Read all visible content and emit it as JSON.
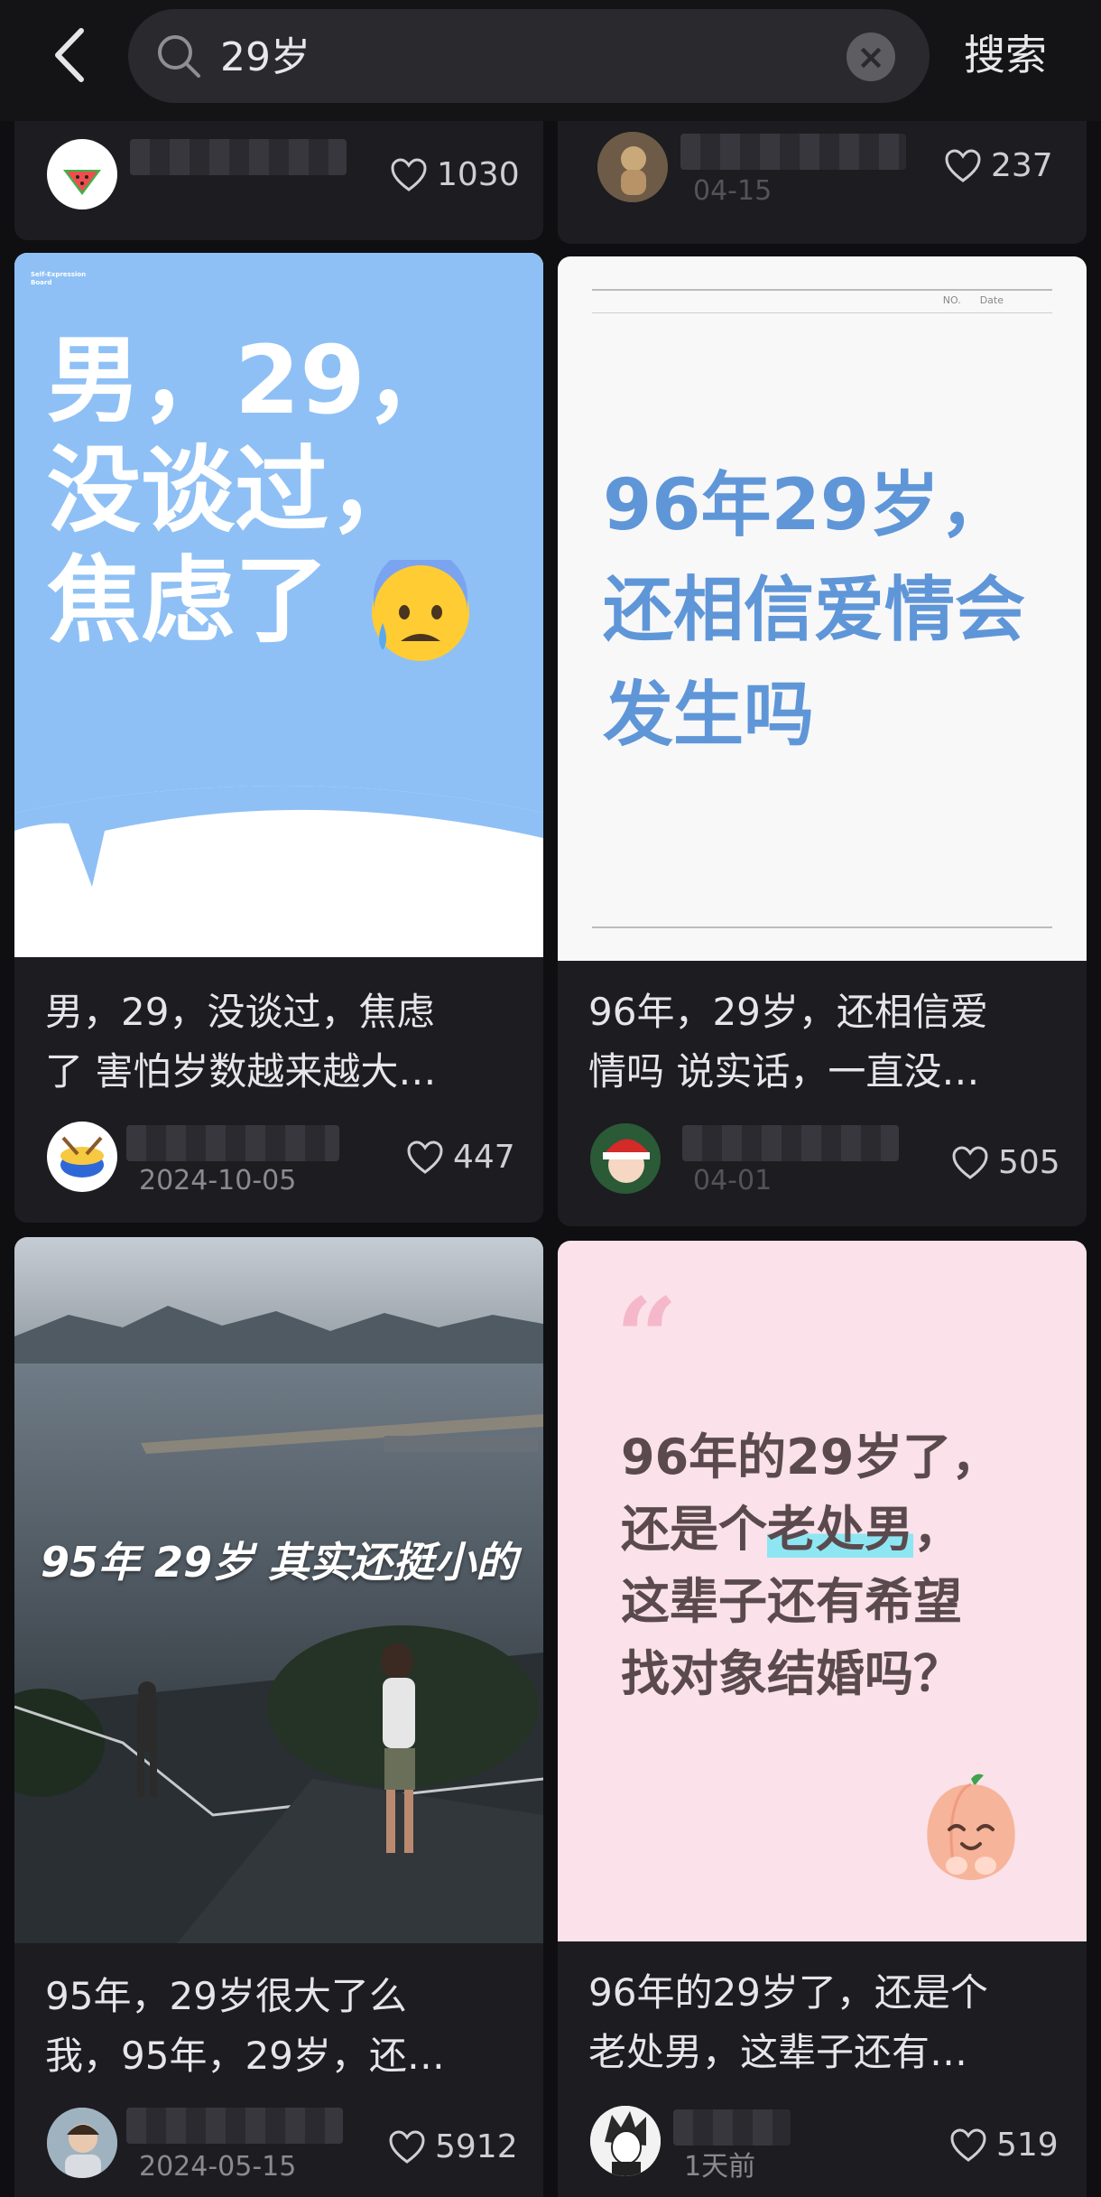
{
  "search": {
    "query": "29岁",
    "button_label": "搜索"
  },
  "cards": [
    {
      "likes": "1030"
    },
    {
      "likes": "237",
      "date": "04-15"
    },
    {
      "cover_badge": "Self-Expression\nBoard",
      "cover_line1": "男，29，",
      "cover_line2": "没谈过，",
      "cover_line3": "焦虑了",
      "title_line1": "男，29，没谈过，焦虑",
      "title_line2": "了 害怕岁数越来越大…",
      "date": "2024-10-05",
      "likes": "447"
    },
    {
      "cover_header": "NO.      Date",
      "cover_line1": "96年29岁，",
      "cover_line2": "还相信爱情会",
      "cover_line3": "发生吗",
      "title_line1": "96年，29岁，还相信爱",
      "title_line2": "情吗 说实话，一直没…",
      "date": "04-01",
      "likes": "505"
    },
    {
      "cover_caption": "95年 29岁 其实还挺小的",
      "title_line1": "95年，29岁很大了么",
      "title_line2": "我，95年，29岁，还…",
      "date": "2024-05-15",
      "likes": "5912"
    },
    {
      "cover_quote": "“",
      "cover_line1": "96年的29岁了，",
      "cover_line2a": "还是个",
      "cover_line2b": "老处男",
      "cover_line2c": "，",
      "cover_line3": "这辈子还有希望",
      "cover_line4": "找对象结婚吗？",
      "title_line1": "96年的29岁了，还是个",
      "title_line2": "老处男，这辈子还有…",
      "date": "1天前",
      "likes": "519"
    }
  ],
  "colors": {
    "background": "#0f0f12",
    "card": "#1c1c21",
    "cover_blue": "#8ec0f5",
    "cover_pink": "#fbe1ea",
    "cover_text_blue": "#5f96d8",
    "highlight": "#8ee6f3"
  },
  "icons": [
    "back-arrow-icon",
    "search-icon",
    "clear-icon",
    "heart-icon"
  ]
}
